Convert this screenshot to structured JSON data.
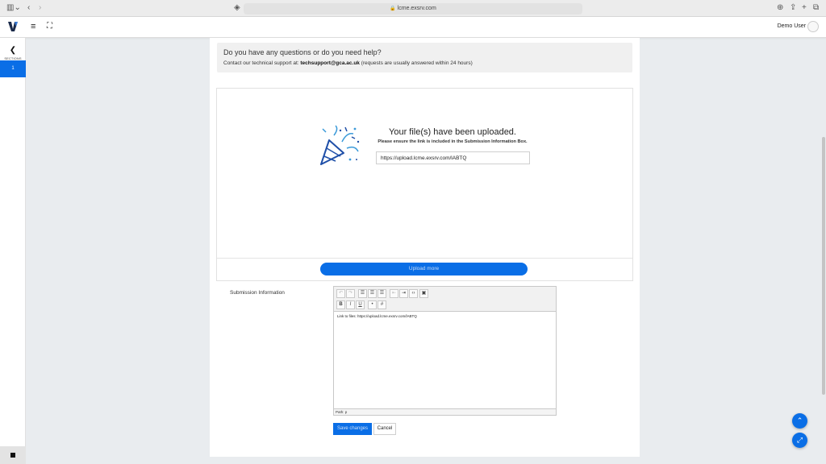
{
  "browser": {
    "url": "lcme.exsrv.com",
    "icons": [
      "sidebar-toggle-icon",
      "chevron-left-icon",
      "chevron-right-icon",
      "shield-icon",
      "reader-icon",
      "download-icon",
      "share-icon",
      "new-tab-icon",
      "tabs-overview-icon"
    ]
  },
  "header": {
    "user_name": "Demo User"
  },
  "sidebar": {
    "label": "SECTIONS",
    "active_section": "1"
  },
  "help": {
    "title": "Do you have any questions or do you need help?",
    "prefix": "Contact our technical support at: ",
    "email": "techsupport@gca.ac.uk",
    "suffix": " (requests are usually answered within 24 hours)"
  },
  "upload": {
    "title": "Your file(s) have been uploaded.",
    "subtitle": "Please ensure the link is included in the Submission Information Box.",
    "link": "https://upload.lcme.exsrv.com/lABTQ",
    "upload_more_label": "Upload more"
  },
  "submission": {
    "label": "Submission Information",
    "editor_text": "Link to files: https://upload.lcme.exsrv.com/lABTQ",
    "path_text": "Path: p"
  },
  "actions": {
    "save_label": "Save changes",
    "cancel_label": "Cancel"
  },
  "colors": {
    "accent": "#0a6ee6",
    "background": "#e9ecef"
  }
}
